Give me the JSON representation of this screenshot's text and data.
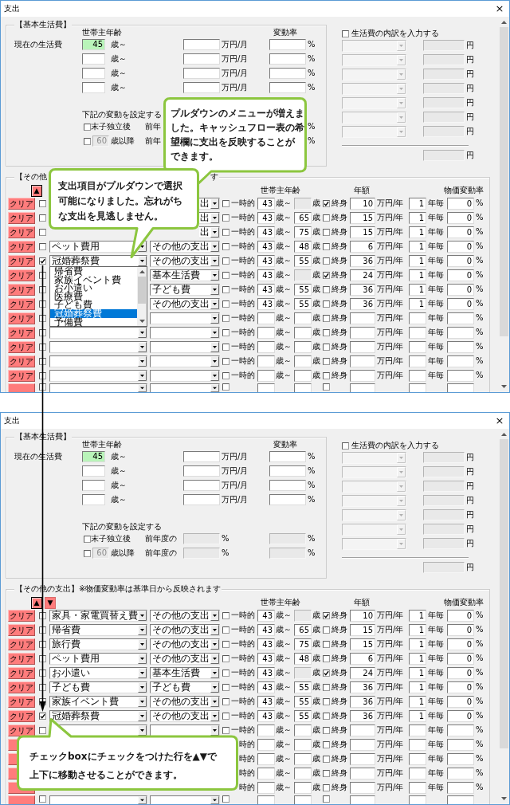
{
  "windows": [
    {
      "title": "支出",
      "close": "×",
      "basic": {
        "title": "【基本生活費】",
        "current_label": "現在の生活費",
        "age_header": "世帯主年齢",
        "rate_header": "変動率",
        "rows": [
          {
            "age": "45",
            "age_highlighted": true,
            "age_unit": "歳～",
            "amount_unit": "万円/月",
            "rate_unit": "%"
          },
          {
            "age_highlighted": false,
            "age_unit": "歳～",
            "amount_unit": "万円/月",
            "rate_unit": "%"
          },
          {
            "age_highlighted": false,
            "age_unit": "歳～",
            "amount_unit": "万円/月",
            "rate_unit": "%"
          },
          {
            "age_highlighted": false,
            "age_unit": "歳～",
            "amount_unit": "万円/月",
            "rate_unit": "%"
          }
        ],
        "change_heading": "下記の変動を設定する",
        "changes": [
          {
            "checked": false,
            "label": "末子独立後",
            "prior_label": "前年",
            "unit_2": "%"
          },
          {
            "checked": false,
            "age": {
              "value": "60",
              "disabled": true
            },
            "label": "歳以降",
            "prior_label": "前年",
            "unit_2": "%"
          }
        ]
      },
      "breakdown": {
        "checked": false,
        "label": "生活費の内訳を入力する",
        "rows": [
          {
            "disabled": true,
            "unit": "円"
          },
          {
            "disabled": true,
            "unit": "円"
          },
          {
            "disabled": true,
            "unit": "円"
          },
          {
            "disabled": true,
            "unit": "円"
          },
          {
            "disabled": true,
            "unit": "円"
          },
          {
            "disabled": true,
            "unit": "円"
          },
          {
            "disabled": true,
            "unit": "円"
          }
        ],
        "total": {
          "disabled": true,
          "unit": "円"
        }
      },
      "other": {
        "title": [
          "【その他",
          "す"
        ],
        "move_buttons": [
          {
            "symbol": "▲",
            "focused": true
          }
        ],
        "age_header": "世帯主年齢",
        "amount_header": "年額",
        "inflation_header": "物価変動率",
        "rows": [
          {
            "kind": "under_note",
            "clear": "クリア",
            "checked": false,
            "category": "出",
            "temporary": false,
            "temporary_label": "一時的",
            "age_from": "43",
            "age_from_unit": "歳～",
            "age_to_unit": "歳",
            "lifetime": true,
            "lifetime_label": "終身",
            "amount": "10",
            "amount_unit": "万円/年",
            "interval": "1",
            "interval_unit": "年毎",
            "inflation": "0",
            "inflation_unit": "%"
          },
          {
            "kind": "under_note",
            "clear": "クリア",
            "checked": false,
            "category": "出",
            "temporary": false,
            "temporary_label": "一時的",
            "age_from": "43",
            "age_from_unit": "歳～",
            "age_to": "65",
            "age_to_unit": "歳",
            "lifetime": false,
            "lifetime_label": "終身",
            "amount": "15",
            "amount_unit": "万円/年",
            "interval": "1",
            "interval_unit": "年毎",
            "inflation": "0",
            "inflation_unit": "%"
          },
          {
            "kind": "under_note",
            "clear": "クリア",
            "checked": false,
            "category": "出",
            "temporary": false,
            "temporary_label": "一時的",
            "age_from": "43",
            "age_from_unit": "歳～",
            "age_to": "75",
            "age_to_unit": "歳",
            "lifetime": false,
            "lifetime_label": "終身",
            "amount": "15",
            "amount_unit": "万円/年",
            "interval": "1",
            "interval_unit": "年毎",
            "inflation": "0",
            "inflation_unit": "%"
          },
          {
            "kind": "plain",
            "clear": "クリア",
            "checked": false,
            "item": "ペット費用",
            "category": "その他の支出",
            "temporary": false,
            "temporary_label": "一時的",
            "age_from": "43",
            "age_from_unit": "歳～",
            "age_to": "48",
            "age_to_unit": "歳",
            "lifetime": false,
            "lifetime_label": "終身",
            "amount": "6",
            "amount_unit": "万円/年",
            "interval": "1",
            "interval_unit": "年毎",
            "inflation": "0",
            "inflation_unit": "%"
          },
          {
            "kind": "plain",
            "clear": "クリア",
            "checked": true,
            "item": "冠婚葬祭費",
            "category": "その他の支出",
            "temporary": false,
            "temporary_label": "一時的",
            "age_from": "43",
            "age_from_unit": "歳～",
            "age_to": "55",
            "age_to_unit": "歳",
            "lifetime": false,
            "lifetime_label": "終身",
            "amount": "36",
            "amount_unit": "万円/年",
            "interval": "1",
            "interval_unit": "年毎",
            "inflation": "0",
            "inflation_unit": "%"
          },
          {
            "kind": "under_list",
            "clear": "クリア",
            "checked": false,
            "category": "基本生活費",
            "temporary": false,
            "temporary_label": "一時的",
            "age_from": "43",
            "age_from_unit": "歳～",
            "age_to_unit": "歳",
            "lifetime": true,
            "lifetime_label": "終身",
            "amount": "24",
            "amount_unit": "万円/年",
            "interval": "1",
            "interval_unit": "年毎",
            "inflation": "0",
            "inflation_unit": "%"
          },
          {
            "kind": "under_list",
            "clear": "クリア",
            "checked": false,
            "category": "子ども費",
            "temporary": false,
            "temporary_label": "一時的",
            "age_from": "43",
            "age_from_unit": "歳～",
            "age_to": "55",
            "age_to_unit": "歳",
            "lifetime": false,
            "lifetime_label": "終身",
            "amount": "36",
            "amount_unit": "万円/年",
            "interval": "1",
            "interval_unit": "年毎",
            "inflation": "0",
            "inflation_unit": "%"
          },
          {
            "kind": "under_list",
            "clear": "クリア",
            "checked": false,
            "category": "その他の支出",
            "temporary": false,
            "temporary_label": "一時的",
            "age_from": "43",
            "age_from_unit": "歳～",
            "age_to": "55",
            "age_to_unit": "歳",
            "lifetime": false,
            "lifetime_label": "終身",
            "amount": "36",
            "amount_unit": "万円/年",
            "interval": "1",
            "interval_unit": "年毎",
            "inflation": "0",
            "inflation_unit": "%"
          },
          {
            "kind": "under_list",
            "clear": "クリア",
            "checked": false,
            "temporary": false,
            "temporary_label": "一時的",
            "age_from_unit": "歳～",
            "age_to_unit": "歳",
            "lifetime": false,
            "lifetime_label": "終身",
            "amount_unit": "万円/年",
            "interval_unit": "年毎",
            "inflation_unit": "%"
          },
          {
            "kind": "plain",
            "clear": "クリア",
            "checked": false,
            "temporary": false,
            "temporary_label": "一時的",
            "age_from_unit": "歳～",
            "age_to_unit": "歳",
            "lifetime": false,
            "lifetime_label": "終身",
            "amount_unit": "万円/年",
            "interval_unit": "年毎",
            "inflation_unit": "%"
          },
          {
            "kind": "plain",
            "clear": "クリア",
            "checked": false,
            "temporary": false,
            "temporary_label": "一時的",
            "age_from_unit": "歳～",
            "age_to_unit": "歳",
            "lifetime": false,
            "lifetime_label": "終身",
            "amount_unit": "万円/年",
            "interval_unit": "年毎",
            "inflation_unit": "%"
          },
          {
            "kind": "plain",
            "clear": "クリア",
            "checked": false,
            "temporary": false,
            "temporary_label": "一時的",
            "age_from_unit": "歳～",
            "age_to_unit": "歳",
            "lifetime": false,
            "lifetime_label": "終身",
            "amount_unit": "万円/年",
            "interval_unit": "年毎",
            "inflation_unit": "%"
          },
          {
            "kind": "plain",
            "clear": "クリア",
            "checked": false,
            "temporary": false,
            "temporary_label": "一時的",
            "age_from_unit": "歳～",
            "age_to_unit": "歳",
            "lifetime": false,
            "lifetime_label": "終身",
            "amount_unit": "万円/年",
            "interval_unit": "年毎",
            "inflation_unit": "%"
          },
          {
            "kind": "cut",
            "checked": false,
            "temporary": false,
            "lifetime": false
          }
        ]
      },
      "dropdown_list": {
        "options": [
          {
            "label": "帰省費",
            "selected": false
          },
          {
            "label": "家族イベント費",
            "selected": false
          },
          {
            "label": "お小遣い",
            "selected": false
          },
          {
            "label": "医療費",
            "selected": false
          },
          {
            "label": "子ども費",
            "selected": false
          },
          {
            "label": "冠婚葬祭費",
            "selected": true
          },
          {
            "label": "予備費",
            "selected": false
          }
        ]
      },
      "callouts": [
        {
          "lines": [
            "プルダウンのメニューが増えま",
            "した。キャッシュフロー表の希",
            "望欄に支出を反映することが",
            "できます。"
          ]
        },
        {
          "lines": [
            "支出項目がプルダウンで選択",
            "可能になりました。忘れがち",
            "な支出を見逃しません。"
          ]
        }
      ]
    },
    {
      "title": "支出",
      "close": "×",
      "basic": {
        "title": "【基本生活費】",
        "current_label": "現在の生活費",
        "age_header": "世帯主年齢",
        "rate_header": "変動率",
        "rows": [
          {
            "age": "45",
            "age_highlighted": true,
            "age_unit": "歳～",
            "amount_unit": "万円/月",
            "rate_unit": "%"
          },
          {
            "age_highlighted": false,
            "age_unit": "歳～",
            "amount_unit": "万円/月",
            "rate_unit": "%"
          },
          {
            "age_highlighted": false,
            "age_unit": "歳～",
            "amount_unit": "万円/月",
            "rate_unit": "%"
          },
          {
            "age_highlighted": false,
            "age_unit": "歳～",
            "amount_unit": "万円/月",
            "rate_unit": "%"
          }
        ],
        "change_heading": "下記の変動を設定する",
        "changes": [
          {
            "checked": false,
            "label": "末子独立後",
            "prior_label": "前年度の",
            "rate_1": {
              "disabled": true
            },
            "unit_1": "%",
            "rate_2": {
              "disabled": true
            },
            "unit_2": "%"
          },
          {
            "checked": false,
            "age": {
              "value": "60",
              "disabled": true
            },
            "label": "歳以降",
            "prior_label": "前年度の",
            "rate_1": {
              "disabled": true
            },
            "unit_1": "%",
            "rate_2": {
              "disabled": true
            },
            "unit_2": "%"
          }
        ]
      },
      "breakdown": {
        "checked": false,
        "label": "生活費の内訳を入力する",
        "rows": [
          {
            "disabled": true,
            "unit": "円"
          },
          {
            "disabled": true,
            "unit": "円"
          },
          {
            "disabled": true,
            "unit": "円"
          },
          {
            "disabled": true,
            "unit": "円"
          },
          {
            "disabled": true,
            "unit": "円"
          },
          {
            "disabled": true,
            "unit": "円"
          },
          {
            "disabled": true,
            "unit": "円"
          }
        ],
        "total": {
          "disabled": true,
          "unit": "円"
        }
      },
      "other": {
        "title": [
          "【その他の支出】※物価変動率は基準日から反映されます"
        ],
        "move_buttons": [
          {
            "symbol": "▲",
            "focused": true
          },
          {
            "symbol": "▼",
            "focused": false
          }
        ],
        "age_header": "世帯主年齢",
        "amount_header": "年額",
        "inflation_header": "物価変動率",
        "rows": [
          {
            "kind": "plain",
            "clear": "クリア",
            "checked": false,
            "item": "家具・家電買替え費",
            "category": "その他の支出",
            "temporary": false,
            "temporary_label": "一時的",
            "age_from": "43",
            "age_from_unit": "歳～",
            "age_to_unit": "歳",
            "lifetime": true,
            "lifetime_label": "終身",
            "amount": "10",
            "amount_unit": "万円/年",
            "interval": "1",
            "interval_unit": "年毎",
            "inflation": "0",
            "inflation_unit": "%"
          },
          {
            "kind": "plain",
            "clear": "クリア",
            "checked": false,
            "item": "帰省費",
            "category": "その他の支出",
            "temporary": false,
            "temporary_label": "一時的",
            "age_from": "43",
            "age_from_unit": "歳～",
            "age_to": "65",
            "age_to_unit": "歳",
            "lifetime": false,
            "lifetime_label": "終身",
            "amount": "15",
            "amount_unit": "万円/年",
            "interval": "1",
            "interval_unit": "年毎",
            "inflation": "0",
            "inflation_unit": "%"
          },
          {
            "kind": "plain",
            "clear": "クリア",
            "checked": false,
            "item": "旅行費",
            "category": "その他の支出",
            "temporary": false,
            "temporary_label": "一時的",
            "age_from": "43",
            "age_from_unit": "歳～",
            "age_to": "75",
            "age_to_unit": "歳",
            "lifetime": false,
            "lifetime_label": "終身",
            "amount": "15",
            "amount_unit": "万円/年",
            "interval": "1",
            "interval_unit": "年毎",
            "inflation": "0",
            "inflation_unit": "%"
          },
          {
            "kind": "plain",
            "clear": "クリア",
            "checked": false,
            "item": "ペット費用",
            "category": "その他の支出",
            "temporary": false,
            "temporary_label": "一時的",
            "age_from": "43",
            "age_from_unit": "歳～",
            "age_to": "48",
            "age_to_unit": "歳",
            "lifetime": false,
            "lifetime_label": "終身",
            "amount": "6",
            "amount_unit": "万円/年",
            "interval": "1",
            "interval_unit": "年毎",
            "inflation": "0",
            "inflation_unit": "%"
          },
          {
            "kind": "plain",
            "clear": "クリア",
            "checked": false,
            "item": "お小遣い",
            "category": "基本生活費",
            "temporary": false,
            "temporary_label": "一時的",
            "age_from": "43",
            "age_from_unit": "歳～",
            "age_to_unit": "歳",
            "lifetime": true,
            "lifetime_label": "終身",
            "amount": "24",
            "amount_unit": "万円/年",
            "interval": "1",
            "interval_unit": "年毎",
            "inflation": "0",
            "inflation_unit": "%"
          },
          {
            "kind": "plain",
            "clear": "クリア",
            "checked": false,
            "item": "子ども費",
            "category": "子ども費",
            "temporary": false,
            "temporary_label": "一時的",
            "age_from": "43",
            "age_from_unit": "歳～",
            "age_to": "55",
            "age_to_unit": "歳",
            "lifetime": false,
            "lifetime_label": "終身",
            "amount": "36",
            "amount_unit": "万円/年",
            "interval": "1",
            "interval_unit": "年毎",
            "inflation": "0",
            "inflation_unit": "%"
          },
          {
            "kind": "plain",
            "clear": "クリア",
            "checked": false,
            "item": "家族イベント費",
            "category": "その他の支出",
            "temporary": false,
            "temporary_label": "一時的",
            "age_from": "43",
            "age_from_unit": "歳～",
            "age_to": "55",
            "age_to_unit": "歳",
            "lifetime": false,
            "lifetime_label": "終身",
            "amount": "36",
            "amount_unit": "万円/年",
            "interval": "1",
            "interval_unit": "年毎",
            "inflation": "0",
            "inflation_unit": "%"
          },
          {
            "kind": "plain",
            "clear": "クリア",
            "checked": true,
            "item": "冠婚葬祭費",
            "category": "その他の支出",
            "temporary": false,
            "temporary_label": "一時的",
            "age_from": "43",
            "age_from_unit": "歳～",
            "age_to": "55",
            "age_to_unit": "歳",
            "lifetime": false,
            "lifetime_label": "終身",
            "amount": "36",
            "amount_unit": "万円/年",
            "interval": "1",
            "interval_unit": "年毎",
            "inflation": "0",
            "inflation_unit": "%"
          },
          {
            "kind": "plain",
            "clear": "クリア",
            "checked": false,
            "temporary": false,
            "temporary_label": "一時的",
            "age_from_unit": "歳～",
            "age_to_unit": "歳",
            "lifetime": false,
            "lifetime_label": "終身",
            "amount_unit": "万円/年",
            "interval_unit": "年毎",
            "inflation_unit": "%"
          },
          {
            "kind": "under_note_wide",
            "temporary_label": "時的",
            "age_from_unit": "歳～",
            "age_to_unit": "歳",
            "lifetime": false,
            "lifetime_label": "終身",
            "amount_unit": "万円/年",
            "interval_unit": "年毎",
            "inflation_unit": "%"
          },
          {
            "kind": "under_note_wide",
            "temporary_label": "時的",
            "age_from_unit": "歳～",
            "age_to_unit": "歳",
            "lifetime": false,
            "lifetime_label": "終身",
            "amount_unit": "万円/年",
            "interval_unit": "年毎",
            "inflation_unit": "%"
          },
          {
            "kind": "under_note_wide",
            "temporary_label": "時的",
            "age_from_unit": "歳～",
            "age_to_unit": "歳",
            "lifetime": false,
            "lifetime_label": "終身",
            "amount_unit": "万円/年",
            "interval_unit": "年毎",
            "inflation_unit": "%"
          },
          {
            "kind": "under_note_wide",
            "temporary_label": "時的",
            "age_from_unit": "歳～",
            "age_to_unit": "歳",
            "lifetime": false,
            "lifetime_label": "終身",
            "amount_unit": "万円/年",
            "interval_unit": "年毎",
            "inflation_unit": "%"
          },
          {
            "kind": "cut",
            "checked": false,
            "temporary": false,
            "lifetime": false
          }
        ]
      },
      "callouts": [
        {
          "lines": [
            "チェックboxにチェックをつけた行を▲▼で",
            "上下に移動させることができます。"
          ]
        }
      ]
    }
  ]
}
